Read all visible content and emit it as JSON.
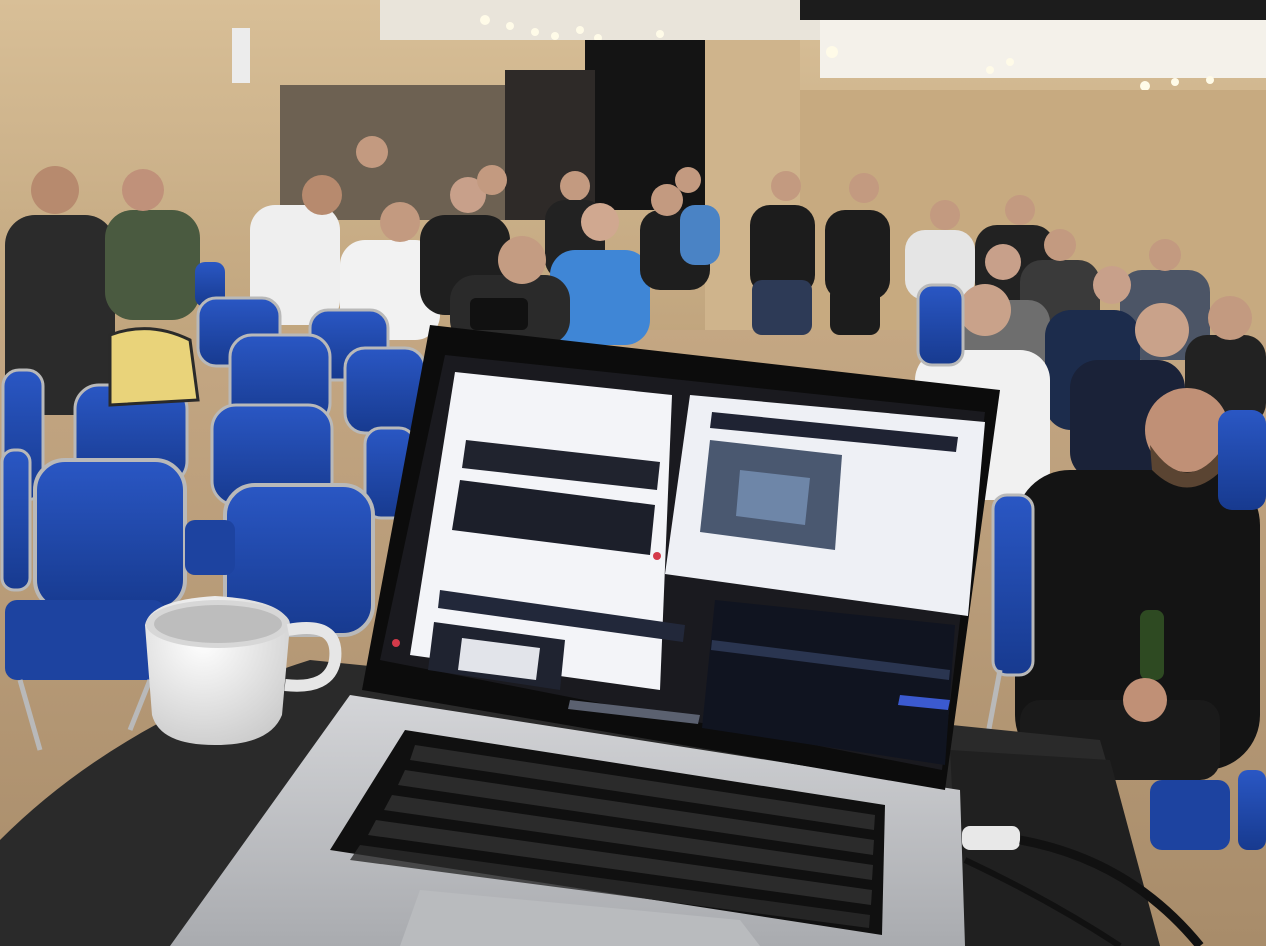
{
  "scene": {
    "description_label": "",
    "colors": {
      "wall": "#c9ad86",
      "floor": "#b89c78",
      "chair_blue": "#1f47a8",
      "chair_frame": "#b9b9b9",
      "table": "#2a2a2a",
      "laptop_body": "#c9cacc",
      "keyboard": "#111111",
      "screen_bezel": "#0c0c0c"
    },
    "icons": [
      "coffee-cup-icon",
      "laptop-icon",
      "camera-icon",
      "bottle-icon"
    ]
  },
  "sweater_print": ""
}
